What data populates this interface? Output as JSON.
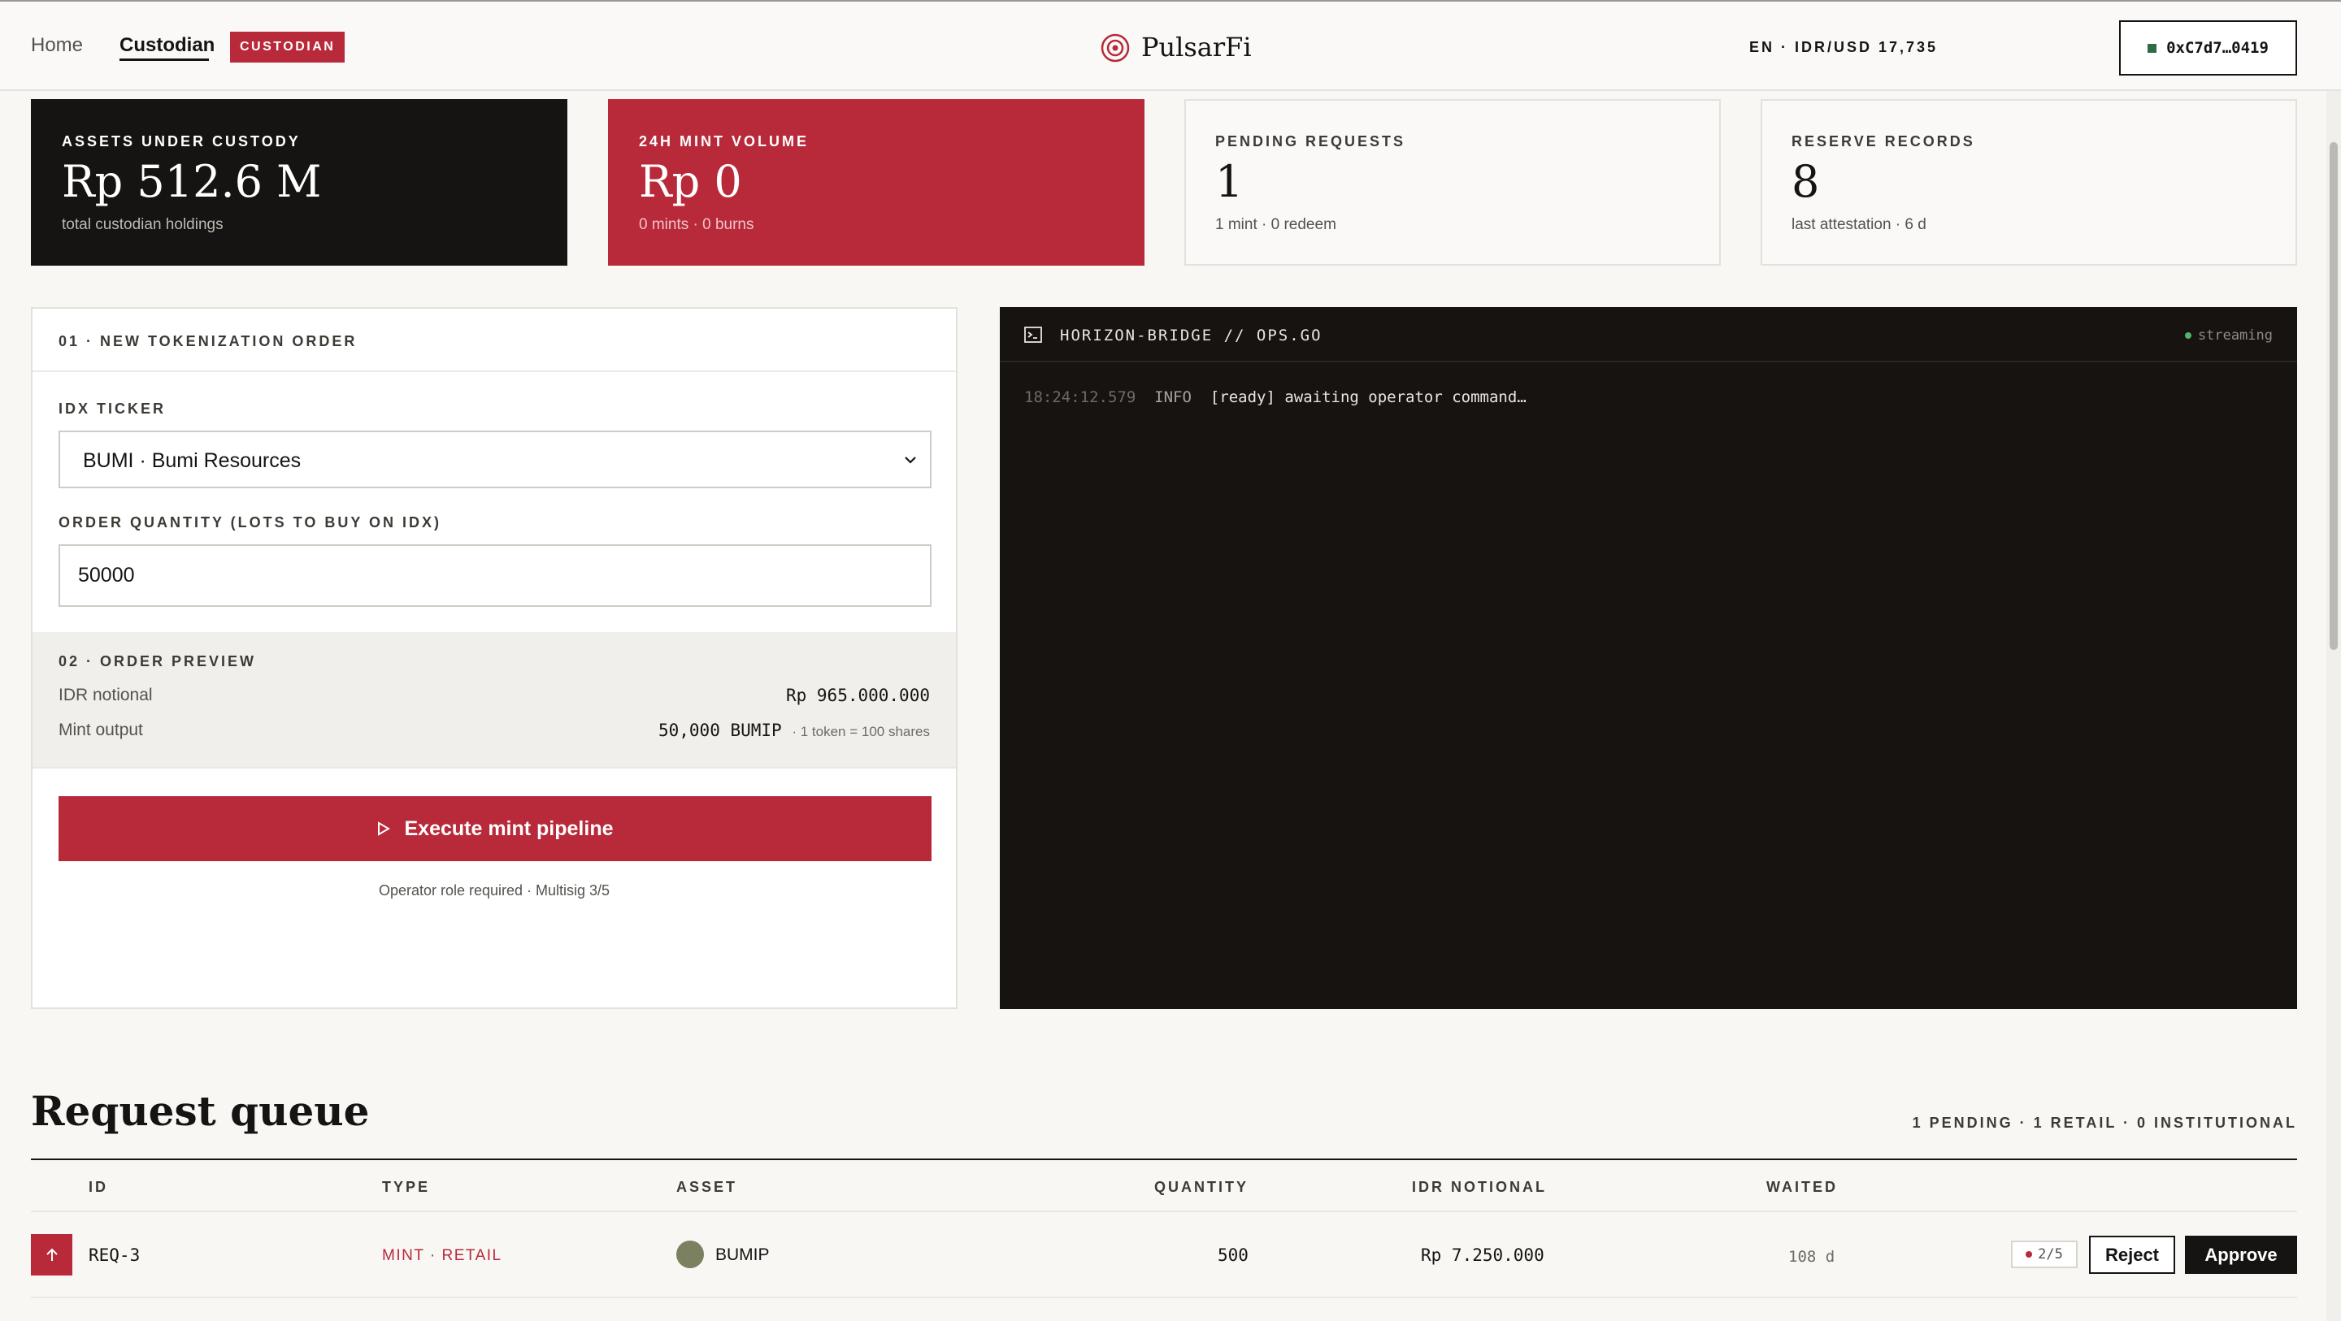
{
  "header": {
    "nav": [
      {
        "label": "Home"
      },
      {
        "label": "Custodian"
      }
    ],
    "role_badge": "CUSTODIAN",
    "brand": "PulsarFi",
    "meta": "EN · IDR/USD 17,735",
    "wallet": "0xC7d7…0419"
  },
  "stats": [
    {
      "label": "ASSETS UNDER CUSTODY",
      "value": "Rp 512.6 M",
      "sub": "total custodian holdings"
    },
    {
      "label": "24H MINT VOLUME",
      "value": "Rp 0",
      "sub": "0 mints · 0 burns"
    },
    {
      "label": "PENDING REQUESTS",
      "value": "1",
      "sub": "1 mint · 0 redeem"
    },
    {
      "label": "RESERVE RECORDS",
      "value": "8",
      "sub": "last attestation · 6 d"
    }
  ],
  "order": {
    "title": "01 · NEW TOKENIZATION ORDER",
    "ticker_label": "IDX TICKER",
    "ticker_value": "BUMI · Bumi Resources",
    "qty_label": "ORDER QUANTITY (LOTS TO BUY ON IDX)",
    "qty_value": "50000",
    "preview_title": "02 · ORDER PREVIEW",
    "notional_label": "IDR notional",
    "notional_value": "Rp 965.000.000",
    "mint_label": "Mint output",
    "mint_value": "50,000 BUMIP",
    "mint_note": "· 1 token = 100 shares",
    "execute_label": "Execute mint pipeline",
    "execute_note": "Operator role required · Multisig 3/5"
  },
  "terminal": {
    "title": "HORIZON-BRIDGE // OPS.GO",
    "status": "streaming",
    "lines": [
      {
        "time": "18:24:12.579",
        "level": "INFO",
        "message": "[ready] awaiting operator command…"
      }
    ]
  },
  "queue": {
    "title": "Request queue",
    "summary": "1 PENDING · 1 RETAIL · 0 INSTITUTIONAL",
    "columns": [
      "ID",
      "TYPE",
      "ASSET",
      "QUANTITY",
      "IDR NOTIONAL",
      "WAITED"
    ],
    "rows": [
      {
        "id": "REQ-3",
        "type": "MINT · RETAIL",
        "asset": "BUMIP",
        "quantity": "500",
        "notional": "Rp 7.250.000",
        "waited": "108 d",
        "signatures": "2/5",
        "reject": "Reject",
        "approve": "Approve"
      }
    ]
  },
  "colors": {
    "accent": "#b8293a",
    "dark": "#161412",
    "status_ok": "#4fb46d",
    "wallet_dot": "#2e6b46"
  },
  "icons": [
    "brand-logo-icon",
    "terminal-icon",
    "chevron-down-icon",
    "play-icon",
    "arrow-up-icon"
  ]
}
